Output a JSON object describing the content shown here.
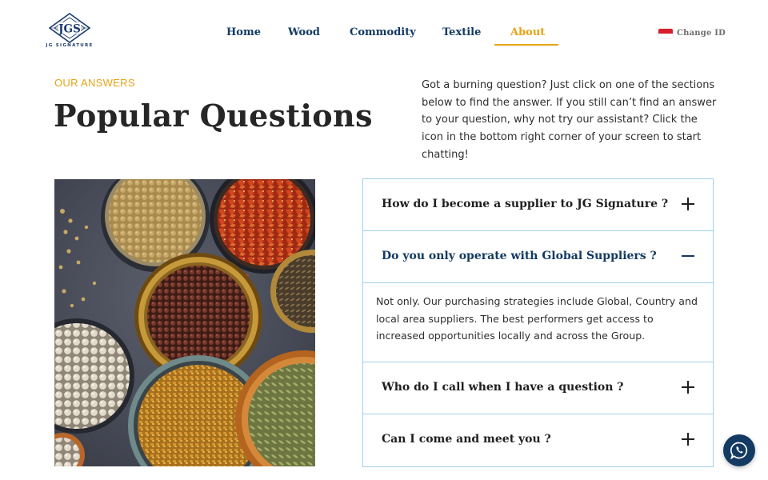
{
  "brand": {
    "monogram": "JGS",
    "caption": "JG SIGNATURE"
  },
  "nav": {
    "items": [
      {
        "label": "Home",
        "active": false
      },
      {
        "label": "Wood",
        "active": false
      },
      {
        "label": "Commodity",
        "active": false
      },
      {
        "label": "Textile",
        "active": false
      },
      {
        "label": "About",
        "active": true
      }
    ],
    "language": {
      "flag": "indonesia-flag-icon",
      "label": "Change ID"
    }
  },
  "intro": {
    "eyebrow": "OUR ANSWERS",
    "title": "Popular Questions",
    "description": "Got a burning question? Just click on one of the sections below to find the answer. If you still can’t find an answer to your question, why not try our assistant? Click the icon in the bottom right corner of your screen to start chatting!"
  },
  "image": {
    "subject": "spices-bowls-image"
  },
  "faq": {
    "items": [
      {
        "question": "How do I become a supplier to JG Signature ?",
        "expanded": false,
        "icon": "plus-icon"
      },
      {
        "question": "Do you only operate with Global Suppliers ?",
        "expanded": true,
        "icon": "minus-icon",
        "answer": "Not only. Our purchasing strategies include Global, Country and local area suppliers. The best performers get access to increased opportunities locally and across the Group."
      },
      {
        "question": "Who do I call when I have a question ?",
        "expanded": false,
        "icon": "plus-icon"
      },
      {
        "question": "Can I come and meet you ?",
        "expanded": false,
        "icon": "plus-icon"
      }
    ]
  },
  "chat": {
    "icon": "whatsapp-chat-icon"
  },
  "colors": {
    "accent": "#e8a317",
    "navy": "#123a63",
    "border": "#9fd2ea",
    "text": "#2e2e2e"
  }
}
